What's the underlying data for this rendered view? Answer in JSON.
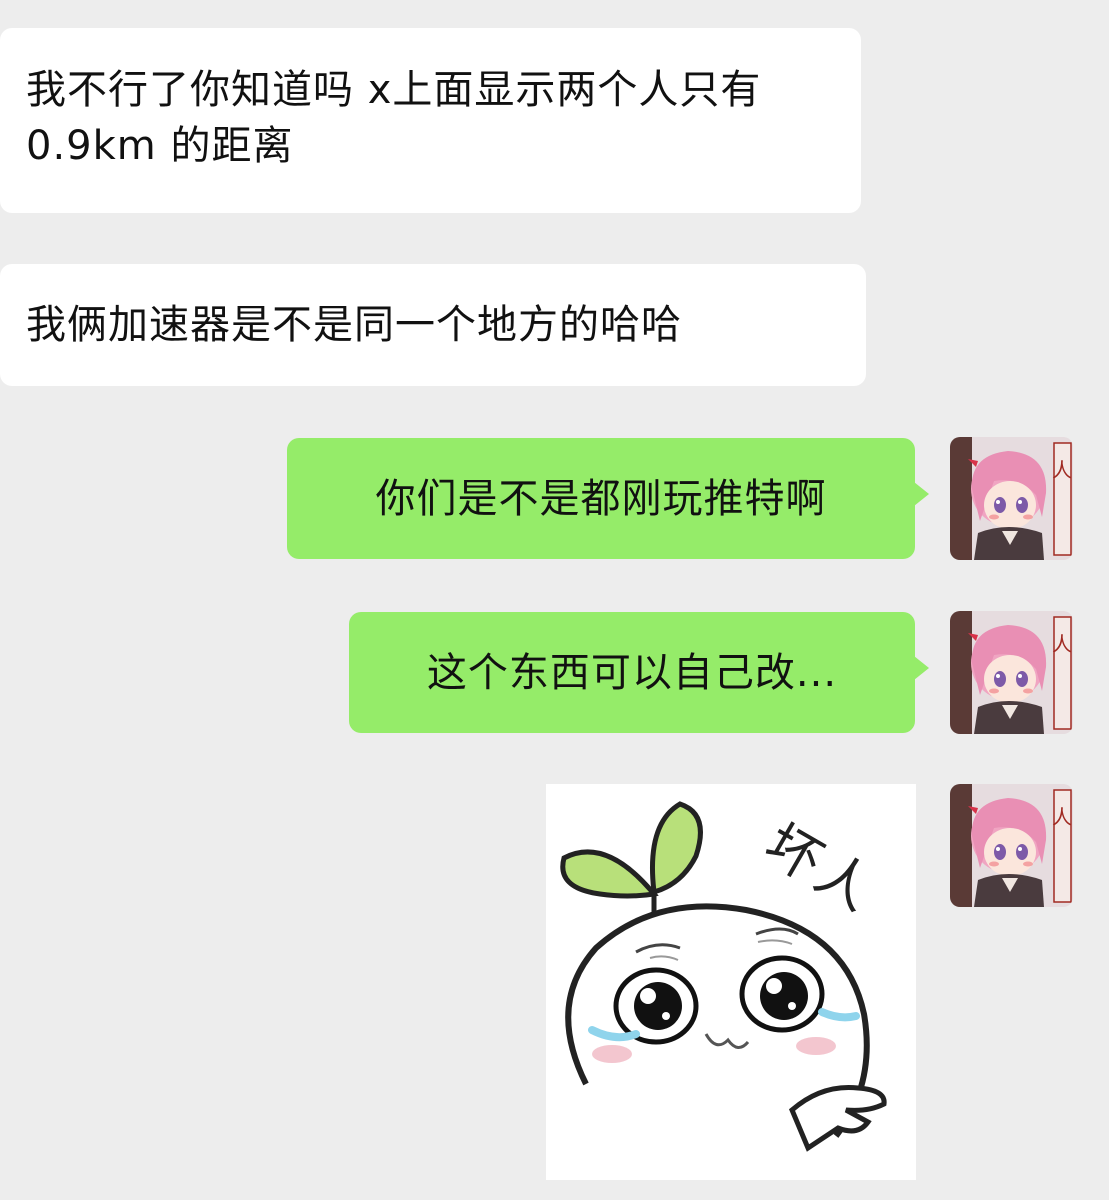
{
  "messages": [
    {
      "side": "incoming",
      "text": "我不行了你知道吗 x上面显示两个人只有 0.9km 的距离"
    },
    {
      "side": "incoming",
      "text": "我俩加速器是不是同一个地方的哈哈"
    },
    {
      "side": "outgoing",
      "text": "你们是不是都刚玩推特啊"
    },
    {
      "side": "outgoing",
      "text": "这个东西可以自己改..."
    }
  ],
  "sticker": {
    "caption": "坏人",
    "icon": "crying-sprout-sticker"
  },
  "avatar": {
    "icon": "anime-girl-avatar",
    "stamp_text": "人"
  },
  "colors": {
    "background": "#ededed",
    "incoming_bubble": "#ffffff",
    "outgoing_bubble": "#95ec69"
  }
}
